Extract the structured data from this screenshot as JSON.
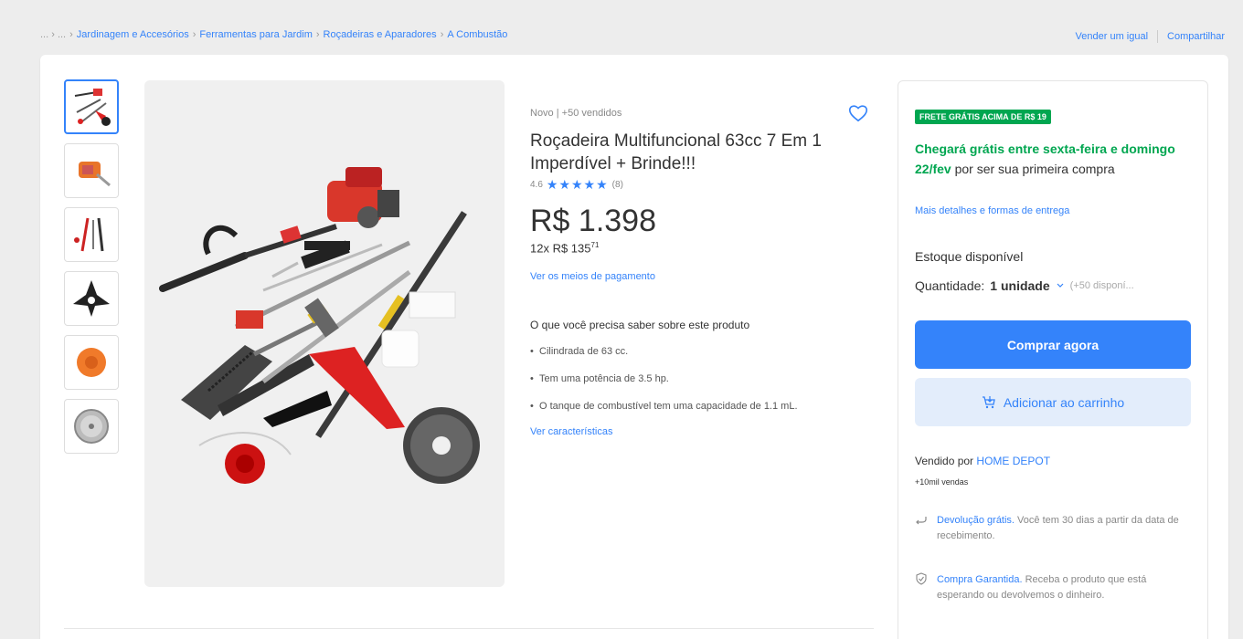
{
  "breadcrumb": {
    "ellipsis": "... › ...",
    "items": [
      "Jardinagem e Accesórios",
      "Ferramentas para Jardim",
      "Roçadeiras e Aparadores",
      "A Combustão"
    ],
    "separator": "›"
  },
  "top_actions": {
    "sell": "Vender um igual",
    "share": "Compartilhar"
  },
  "product": {
    "condition": "Novo  |  +50 vendidos",
    "title": "Roçadeira Multifuncional 63cc 7 Em 1 Imperdível + Brinde!!!",
    "rating_value": "4.6",
    "rating_stars": 4.6,
    "rating_count": "(8)",
    "price": "R$ 1.398",
    "installments_prefix": "12x R$ 135",
    "installments_cents": "71",
    "payment_link": "Ver os meios de pagamento",
    "know_title": "O que você precisa saber sobre este produto",
    "features": [
      "Cilindrada de 63 cc.",
      "Tem uma potência de 3.5 hp.",
      "O tanque de combustível tem uma capacidade de 1.1 mL."
    ],
    "see_features": "Ver características"
  },
  "buybox": {
    "badge": "FRETE GRÁTIS ACIMA DE R$ 19",
    "ship_green": "Chegará grátis entre sexta-feira e domingo 22/fev",
    "ship_rest": " por ser sua primeira compra",
    "delivery_link": "Mais detalhes e formas de entrega",
    "stock": "Estoque disponível",
    "qty_label": "Quantidade:",
    "qty_value": "1 unidade",
    "qty_available": "(+50 disponí...",
    "buy_now": "Comprar agora",
    "add_cart": "Adicionar ao carrinho",
    "sold_by": "Vendido por",
    "seller": "HOME DEPOT",
    "sales": "+10mil vendas",
    "return_link": "Devolução grátis.",
    "return_text": " Você tem 30 dias a partir da data de recebimento.",
    "guarantee_link": "Compra Garantida.",
    "guarantee_text": " Receba o produto que está esperando ou devolvemos o dinheiro."
  },
  "colors": {
    "accent": "#3483fa",
    "green": "#00a650"
  }
}
